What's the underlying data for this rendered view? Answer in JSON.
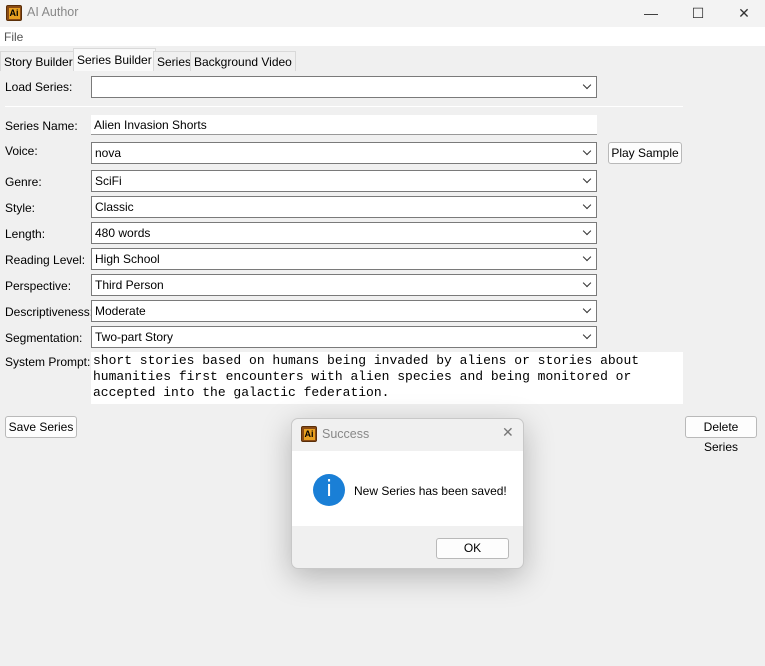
{
  "window": {
    "title": "AI Author",
    "icon_text": "Ai",
    "minimize": "—",
    "maximize": "☐",
    "close": "✕"
  },
  "menu": {
    "file": "File"
  },
  "tabs": [
    "Story Builder",
    "Series Builder",
    "Series",
    "Background Video"
  ],
  "form": {
    "load_series": {
      "label": "Load Series:",
      "value": ""
    },
    "series_name": {
      "label": "Series Name:",
      "value": "Alien Invasion Shorts"
    },
    "voice": {
      "label": "Voice:",
      "value": "nova"
    },
    "genre": {
      "label": "Genre:",
      "value": "SciFi"
    },
    "style": {
      "label": "Style:",
      "value": "Classic"
    },
    "length": {
      "label": "Length:",
      "value": "480 words"
    },
    "reading_level": {
      "label": "Reading Level:",
      "value": "High School"
    },
    "perspective": {
      "label": "Perspective:",
      "value": "Third Person"
    },
    "descriptiveness": {
      "label": "Descriptiveness:",
      "value": "Moderate"
    },
    "segmentation": {
      "label": "Segmentation:",
      "value": "Two-part Story"
    },
    "system_prompt": {
      "label": "System Prompt:",
      "value": "short stories based on humans being invaded by aliens or stories about humanities first encounters with alien species and being monitored or accepted into the galactic federation."
    }
  },
  "buttons": {
    "play_sample": "Play Sample",
    "save_series": "Save Series",
    "delete_series": "Delete Series"
  },
  "dialog": {
    "title": "Success",
    "message": "New Series has been saved!",
    "ok": "OK",
    "icon": "info-icon",
    "close": "✕"
  }
}
